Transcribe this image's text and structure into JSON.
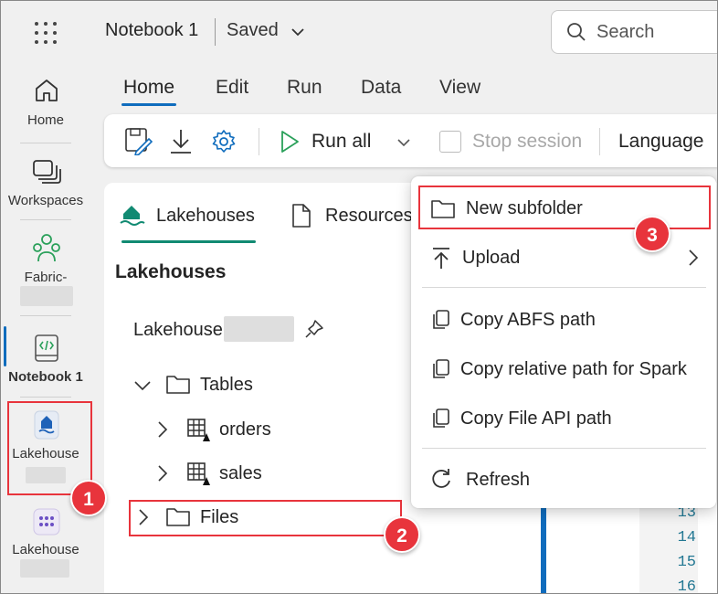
{
  "app": {
    "title": "Notebook 1",
    "status": "Saved"
  },
  "search": {
    "placeholder": "Search"
  },
  "rail": {
    "home": "Home",
    "workspaces": "Workspaces",
    "fabric": "Fabric-",
    "notebook": "Notebook 1",
    "lakehouse_active": "Lakehouse",
    "lakehouse_other": "Lakehouse"
  },
  "menu_tabs": [
    "Home",
    "Edit",
    "Run",
    "Data",
    "View"
  ],
  "toolbar": {
    "run_all": "Run all",
    "stop_session": "Stop session",
    "language": "Language"
  },
  "explorer": {
    "tab_lakehouses": "Lakehouses",
    "tab_resources": "Resources",
    "heading": "Lakehouses",
    "lakehouse_name": "Lakehouse",
    "tables": "Tables",
    "table_orders": "orders",
    "table_sales": "sales",
    "files": "Files"
  },
  "context_menu": {
    "new_subfolder": "New subfolder",
    "upload": "Upload",
    "copy_abfs": "Copy ABFS path",
    "copy_relative": "Copy relative path for Spark",
    "copy_file_api": "Copy File API path",
    "refresh": "Refresh"
  },
  "line_numbers": [
    "13",
    "14",
    "15",
    "16"
  ],
  "annotations": {
    "badge1": "1",
    "badge2": "2",
    "badge3": "3"
  },
  "colors": {
    "accent": "#0f6cbd",
    "annotation_red": "#e8343c",
    "green_icon": "#2aa05a"
  }
}
